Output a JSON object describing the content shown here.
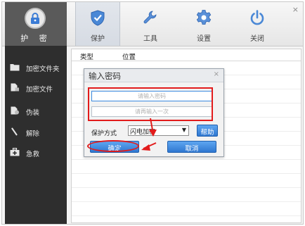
{
  "app": {
    "logo_label": "护 密",
    "close_glyph": "×"
  },
  "nav": [
    {
      "label": "保护",
      "icon": "shield-check-icon",
      "active": true
    },
    {
      "label": "工具",
      "icon": "wrench-icon",
      "active": false
    },
    {
      "label": "设置",
      "icon": "gear-icon",
      "active": false
    },
    {
      "label": "关闭",
      "icon": "power-icon",
      "active": false
    }
  ],
  "sidebar": {
    "items": [
      {
        "label": "加密文件夹",
        "icon": "folder-icon"
      },
      {
        "label": "加密文件",
        "icon": "file-lock-icon"
      },
      {
        "label": "伪装",
        "icon": "disguise-file-icon"
      },
      {
        "label": "解除",
        "icon": "unlock-wand-icon"
      },
      {
        "label": "急救",
        "icon": "first-aid-kit-icon"
      }
    ]
  },
  "table": {
    "headers": [
      "类型",
      "位置"
    ]
  },
  "dialog": {
    "title": "输入密码",
    "close_glyph": "×",
    "password_placeholder": "请输入密码",
    "confirm_placeholder": "请再输入一次",
    "protect_label": "保护方式",
    "protect_value": "闪电加密",
    "help_label": "帮助",
    "ok_label": "确定",
    "cancel_label": "取消"
  },
  "colors": {
    "accent_blue": "#2f77d1",
    "annotation_red": "#e21b1b",
    "sidebar_bg": "#2e2e2e"
  }
}
